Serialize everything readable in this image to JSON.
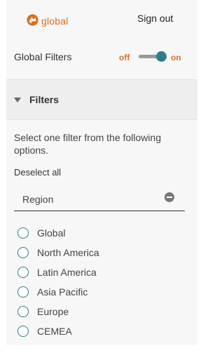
{
  "header": {
    "logo_text": "global",
    "signout_label": "Sign out"
  },
  "global_filters": {
    "label": "Global Filters",
    "off_label": "off",
    "on_label": "on",
    "state": "on"
  },
  "filters": {
    "title": "Filters",
    "instructions": "Select one filter from the following options.",
    "deselect_label": "Deselect all",
    "region_label": "Region",
    "options": [
      "Global",
      "North America",
      "Latin America",
      "Asia Pacific",
      "Europe",
      "CEMEA"
    ]
  },
  "colors": {
    "accent_orange": "#e06a1f",
    "toggle_teal": "#2f7d86",
    "panel_bg": "#f7f7f7"
  }
}
